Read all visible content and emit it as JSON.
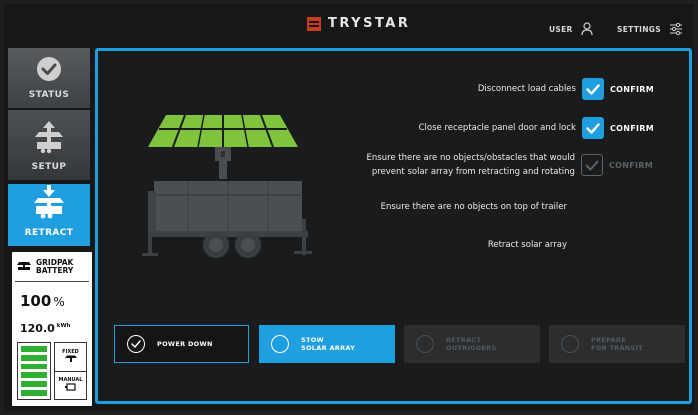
{
  "header": {
    "logo_text": "TRYSTAR",
    "user_label": "USER",
    "settings_label": "SETTINGS"
  },
  "sidebar": {
    "tabs": [
      {
        "label": "STATUS",
        "icon": "check-circle-icon",
        "active": false
      },
      {
        "label": "SETUP",
        "icon": "solar-array-up-icon",
        "active": false
      },
      {
        "label": "RETRACT",
        "icon": "solar-array-retract-icon",
        "active": true
      }
    ],
    "battery": {
      "title_line1": "GRIDPAK",
      "title_line2": "BATTERY",
      "percent": "100",
      "percent_unit": "%",
      "energy": "120.0",
      "energy_unit": "kWh",
      "bar_count": 6,
      "mode_fixed": "FIXED",
      "mode_manual": "MANUAL"
    }
  },
  "checklist": [
    {
      "text": "Disconnect load cables",
      "checkbox": "checked",
      "confirm": "CONFIRM"
    },
    {
      "text": "Close receptacle panel door and lock",
      "checkbox": "checked",
      "confirm": "CONFIRM"
    },
    {
      "text": "Ensure there are no objects/obstacles that would\nprevent solar array from retracting and rotating",
      "checkbox": "disabled",
      "confirm": "CONFIRM"
    },
    {
      "text": "Ensure there are no objects on top of trailer",
      "checkbox": "none",
      "confirm": ""
    },
    {
      "text": "Retract solar array",
      "checkbox": "none",
      "confirm": ""
    }
  ],
  "steps": [
    {
      "label": "POWER DOWN",
      "state": "done"
    },
    {
      "label": "STOW\nSOLAR ARRAY",
      "state": "active"
    },
    {
      "label": "RETRACT\nOUTRIGGERS",
      "state": "disabled"
    },
    {
      "label": "PREPARE\nFOR TRANSIT",
      "state": "disabled"
    }
  ],
  "colors": {
    "accent": "#1f9ee0",
    "panel_green": "#7fc43c",
    "battery_green": "#2fae2f",
    "logo_red": "#c93b1e"
  }
}
